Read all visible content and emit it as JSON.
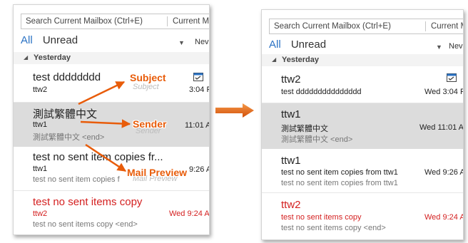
{
  "search": {
    "placeholder": "Search Current Mailbox (Ctrl+E)",
    "scope": "Current M"
  },
  "filters": {
    "all": "All",
    "unread": "Unread",
    "new_label": "Nev"
  },
  "group_label": "Yesterday",
  "left": {
    "messages": [
      {
        "line1": "test dddddddd",
        "line2": "ttw2",
        "line3": "",
        "time": "3:04 P"
      },
      {
        "line1": "測試繁體中文",
        "line2": "ttw1",
        "line3": "測試繁體中文 <end>",
        "time": "11:01 A"
      },
      {
        "line1": "test no sent item copies fr...",
        "line2": "ttw1",
        "line3": "test no sent item copies f",
        "time": "9:26 A"
      },
      {
        "line1": "test no sent items copy",
        "line2": "ttw2",
        "line3": "test no sent items copy <end>",
        "time": "Wed 9:24 A"
      }
    ]
  },
  "right": {
    "messages": [
      {
        "line1": "ttw2",
        "line2": "test ddddddddddddddd",
        "line3": "",
        "time": "Wed 3:04 P"
      },
      {
        "line1": "ttw1",
        "line2": "測試繁體中文",
        "line3": "測試繁體中文 <end>",
        "time": "Wed 11:01 A"
      },
      {
        "line1": "ttw1",
        "line2": "test no sent item copies from ttw1",
        "line3": "test no sent item copies from ttw1",
        "time": "Wed 9:26 A"
      },
      {
        "line1": "ttw2",
        "line2": "test no sent items copy",
        "line3": "test no sent items copy <end>",
        "time": "Wed 9:24 A"
      }
    ]
  },
  "annotations": {
    "subject": "Subject",
    "sender": "Sender",
    "preview": "Mail Preview"
  },
  "colors": {
    "accent_blue": "#2a72c4",
    "unread_red": "#d42020",
    "annotation_orange": "#e85c0a",
    "selected_row": "#dcdcdc"
  }
}
